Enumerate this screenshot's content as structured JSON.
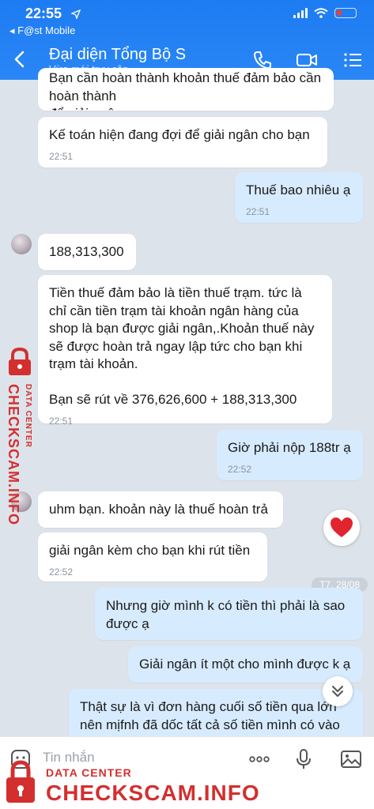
{
  "status_bar": {
    "time": "22:55",
    "carrier": "◂ F@st Mobile"
  },
  "header": {
    "title": "Đại diện Tổng Bộ S",
    "subtitle": "Vừa mới truy cập"
  },
  "messages": [
    {
      "dir": "in",
      "text": "Bạn cần hoàn thành khoản thuế đảm bảo cần hoàn thành\nđể giải ngân",
      "time": ""
    },
    {
      "dir": "in",
      "text": "Kế toán hiện đang đợi để giải ngân cho bạn",
      "time": "22:51"
    },
    {
      "dir": "out",
      "text": "Thuế bao nhiêu ạ",
      "time": "22:51"
    },
    {
      "dir": "in",
      "text": "188,313,300",
      "time": ""
    },
    {
      "dir": "in",
      "text": "Tiền thuế đảm bảo là tiền thuế trạm. tức là\nchỉ cần tiền trạm tài khoản ngân hàng của\nshop là bạn được giải ngân,.Khoản thuế này\nsẽ được hoàn trả ngay lập tức cho bạn khi\ntrạm tài khoản.\n\nBạn sẽ rút về 376,626,600 + 188,313,300",
      "time": "22:51"
    },
    {
      "dir": "out",
      "text": "Giờ phải nộp 188tr ạ",
      "time": "22:52"
    },
    {
      "dir": "in",
      "text": "uhm bạn. khoản này là thuế hoàn trả",
      "time": ""
    },
    {
      "dir": "in",
      "text": "giải ngân kèm cho bạn khi rút tiền",
      "time": "22:52"
    },
    {
      "dir": "out",
      "text": "Nhưng giờ mình k có tiền thì phải là sao\nđược ạ",
      "time": ""
    },
    {
      "dir": "out",
      "text": "Giải ngân ít một cho mình được k ạ",
      "time": ""
    },
    {
      "dir": "out",
      "text": "Thật sự là vì đơn hàng cuối số tiền qua lớn\nnên mịfnh đã dốc tất cả số tiền mình có vào\nđó rồi",
      "time": ""
    }
  ],
  "date_chip": "T7, 28/08",
  "input": {
    "placeholder": "Tin nhắn"
  },
  "watermark": {
    "line1": "DATA CENTER",
    "line2": "CHECKSCAM.INFO"
  },
  "colors": {
    "header": "#2a86f5",
    "incoming": "#ffffff",
    "outgoing": "#d7ebfe",
    "background": "#dde3ea",
    "watermark": "#d32f2f"
  },
  "icons": [
    "back-arrow-icon",
    "phone-icon",
    "video-call-icon",
    "menu-list-icon",
    "heart-icon",
    "chevron-double-down-icon",
    "sticker-icon",
    "more-icon",
    "microphone-icon",
    "image-icon",
    "lock-icon"
  ]
}
